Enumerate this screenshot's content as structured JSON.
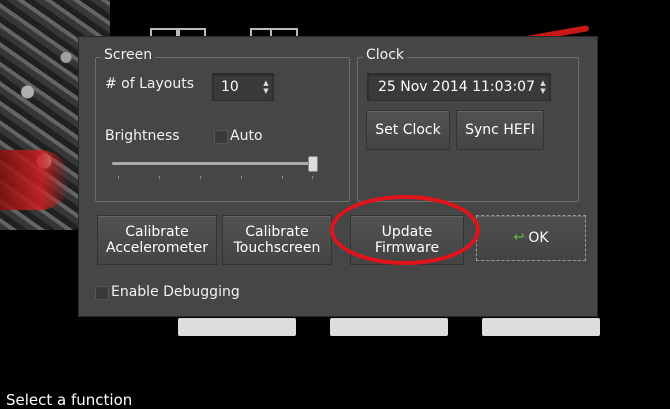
{
  "screen": {
    "title": "Screen",
    "layouts_label": "# of Layouts",
    "layouts_value": "10",
    "brightness_label": "Brightness",
    "auto_label": "Auto"
  },
  "clock": {
    "title": "Clock",
    "datetime_value": "25 Nov 2014 11:03:07",
    "set_clock_label": "Set Clock",
    "sync_label": "Sync HEFI"
  },
  "actions": {
    "calibrate_accel_line1": "Calibrate",
    "calibrate_accel_line2": "Accelerometer",
    "calibrate_touch_line1": "Calibrate",
    "calibrate_touch_line2": "Touchscreen",
    "update_fw_line1": "Update",
    "update_fw_line2": "Firmware",
    "ok_label": "OK",
    "ok_icon": "checkmark-icon"
  },
  "debug_label": "Enable Debugging",
  "status_text": "Select a function",
  "brightness_level": 1.0,
  "colors": {
    "dialog_bg": "#464646",
    "highlight_ring": "#e0141a",
    "ok_icon": "#6bbf3a"
  }
}
